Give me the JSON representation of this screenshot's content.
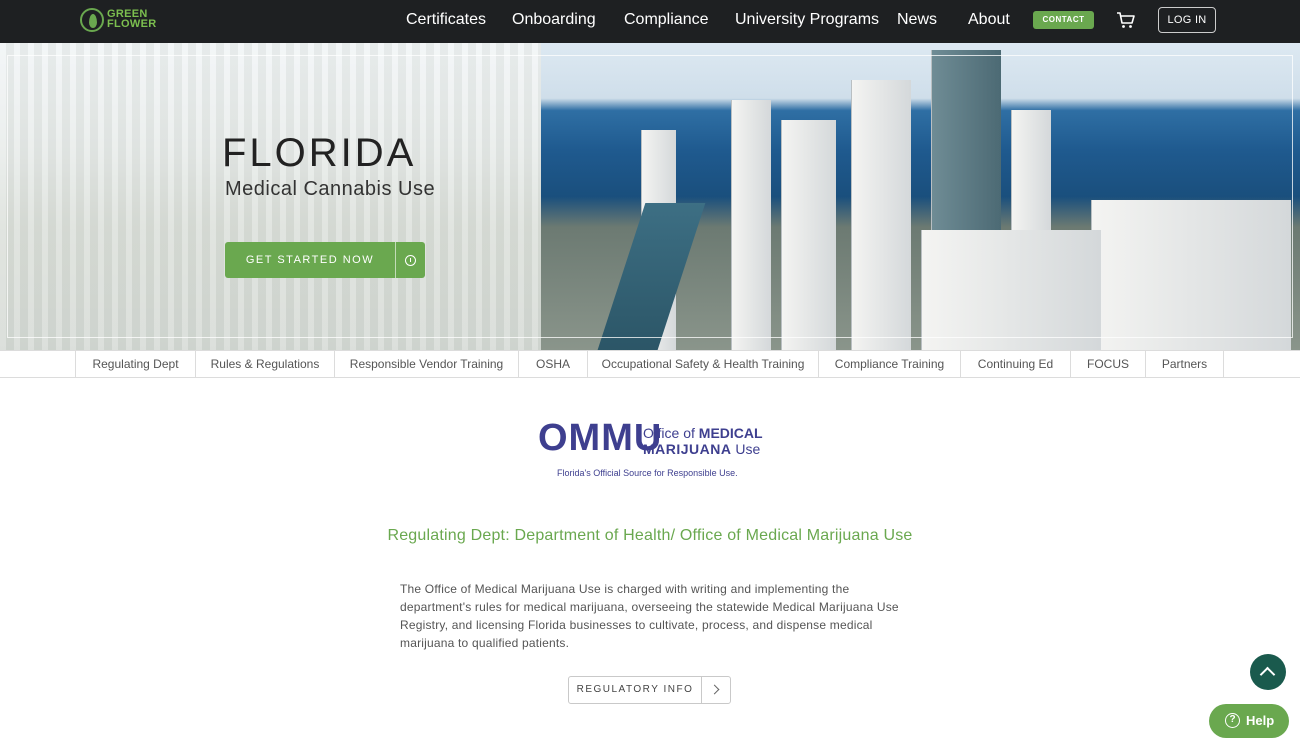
{
  "brand": {
    "logo_text_line1": "GREEN",
    "logo_text_line2": "FLOWER",
    "accent": "#6aa84f",
    "navbar_bg": "#1e2022"
  },
  "nav": {
    "items": [
      {
        "label": "Certificates"
      },
      {
        "label": "Onboarding"
      },
      {
        "label": "Compliance"
      },
      {
        "label": "University Programs"
      },
      {
        "label": "News"
      },
      {
        "label": "About"
      }
    ],
    "contact_label": "CONTACT",
    "cart_icon": "cart-icon",
    "login_label": "LOG IN"
  },
  "hero": {
    "title": "FLORIDA",
    "subtitle": "Medical Cannabis Use",
    "cta_label": "GET STARTED NOW",
    "cta_icon": "info-icon"
  },
  "subnav": {
    "items": [
      {
        "label": "Regulating Dept"
      },
      {
        "label": "Rules & Regulations"
      },
      {
        "label": "Responsible Vendor Training"
      },
      {
        "label": "OSHA"
      },
      {
        "label": "Occupational Safety & Health Training"
      },
      {
        "label": "Compliance Training"
      },
      {
        "label": "Continuing Ed"
      },
      {
        "label": "FOCUS"
      },
      {
        "label": "Partners"
      }
    ]
  },
  "ommu_logo": {
    "big": "OMMU",
    "line1_a": "Office of ",
    "line1_b": "MEDICAL",
    "line2_a": "MARIJUANA",
    "line2_b": " Use",
    "tagline": "Florida's Official Source for Responsible Use.",
    "color": "#3e3f8f"
  },
  "section": {
    "title": "Regulating Dept: Department of Health/ Office of Medical Marijuana Use",
    "body": "The Office of Medical Marijuana Use is charged with writing and implementing the department's rules for medical marijuana, overseeing the statewide Medical Marijuana Use Registry, and licensing Florida businesses to cultivate, process, and dispense medical marijuana to qualified patients.",
    "button_label": "REGULATORY INFO"
  },
  "widgets": {
    "scroll_top_icon": "chevron-up-icon",
    "help_label": "Help",
    "help_icon": "question-circle-icon",
    "scroll_top_color": "#1a5a4d"
  }
}
